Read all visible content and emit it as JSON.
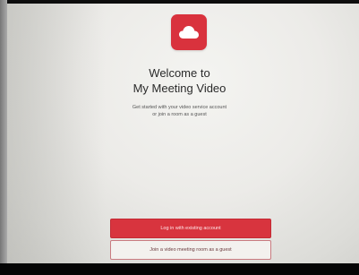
{
  "app": {
    "logo_icon": "cloud-icon",
    "brand_color": "#d9323d"
  },
  "welcome": {
    "line1": "Welcome to",
    "line2": "My Meeting Video"
  },
  "subtitle": {
    "line1": "Get started with your video service account",
    "line2": "or join a room as a guest"
  },
  "buttons": {
    "login_label": "Log in with existing account",
    "guest_label": "Join a video meeting room as a guest"
  }
}
